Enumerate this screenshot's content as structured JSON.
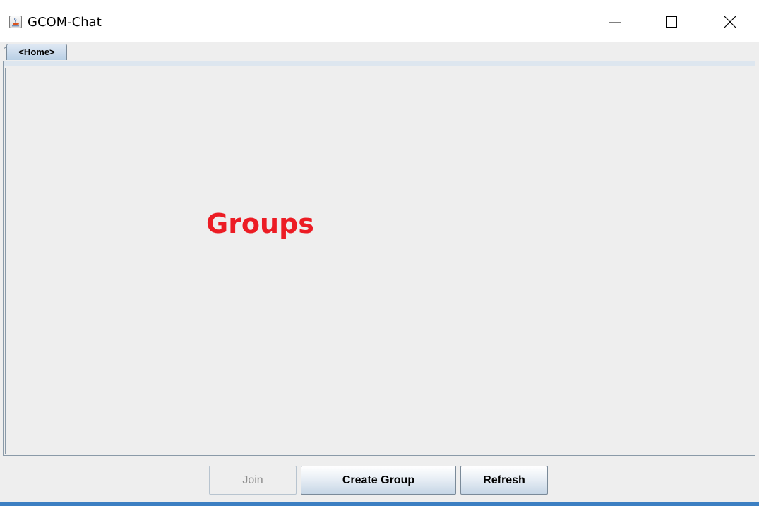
{
  "window": {
    "title": "GCOM-Chat",
    "app_icon": "java-cup-icon",
    "controls": [
      "minimize-icon",
      "maximize-icon",
      "close-icon"
    ]
  },
  "tabs": [
    {
      "label": "<Home>",
      "selected": true
    }
  ],
  "main": {
    "heading": "Groups",
    "heading_color": "#ec1c24"
  },
  "buttons": {
    "join": {
      "label": "Join",
      "enabled": false
    },
    "create_group": {
      "label": "Create Group",
      "enabled": true
    },
    "refresh": {
      "label": "Refresh",
      "enabled": true
    }
  },
  "colors": {
    "window_background": "#eeeeee",
    "accent_border": "#3c7fc2"
  }
}
